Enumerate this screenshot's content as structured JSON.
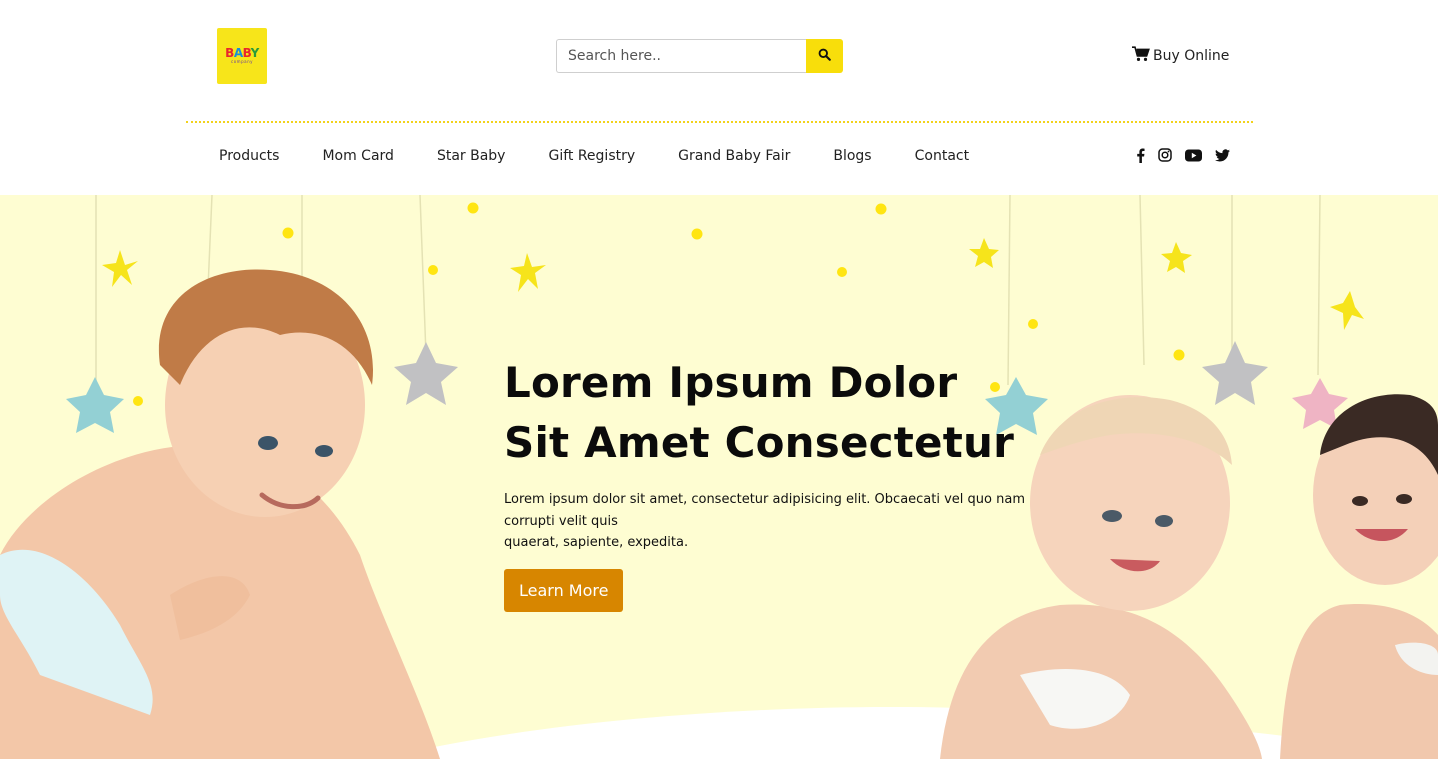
{
  "brand": {
    "logo_main": "BABY",
    "logo_sub": "company"
  },
  "search": {
    "placeholder": "Search here.."
  },
  "header": {
    "buy_online": "Buy Online"
  },
  "nav": {
    "items": [
      {
        "label": "Products"
      },
      {
        "label": "Mom Card"
      },
      {
        "label": "Star Baby"
      },
      {
        "label": "Gift Registry"
      },
      {
        "label": "Grand Baby Fair"
      },
      {
        "label": "Blogs"
      },
      {
        "label": "Contact"
      }
    ]
  },
  "social": [
    "facebook-icon",
    "instagram-icon",
    "youtube-icon",
    "twitter-icon"
  ],
  "hero": {
    "title_line1": "Lorem Ipsum Dolor",
    "title_line2": "Sit Amet Consectetur",
    "desc_line1": "Lorem ipsum dolor sit amet, consectetur adipisicing elit. Obcaecati vel quo nam corrupti velit quis",
    "desc_line2": "quaerat, sapiente, expedita.",
    "button": "Learn More"
  },
  "colors": {
    "accent": "#f8de0b",
    "button": "#d78600",
    "hero_bg": "#fefdd2",
    "divider": "#f2d21b"
  }
}
